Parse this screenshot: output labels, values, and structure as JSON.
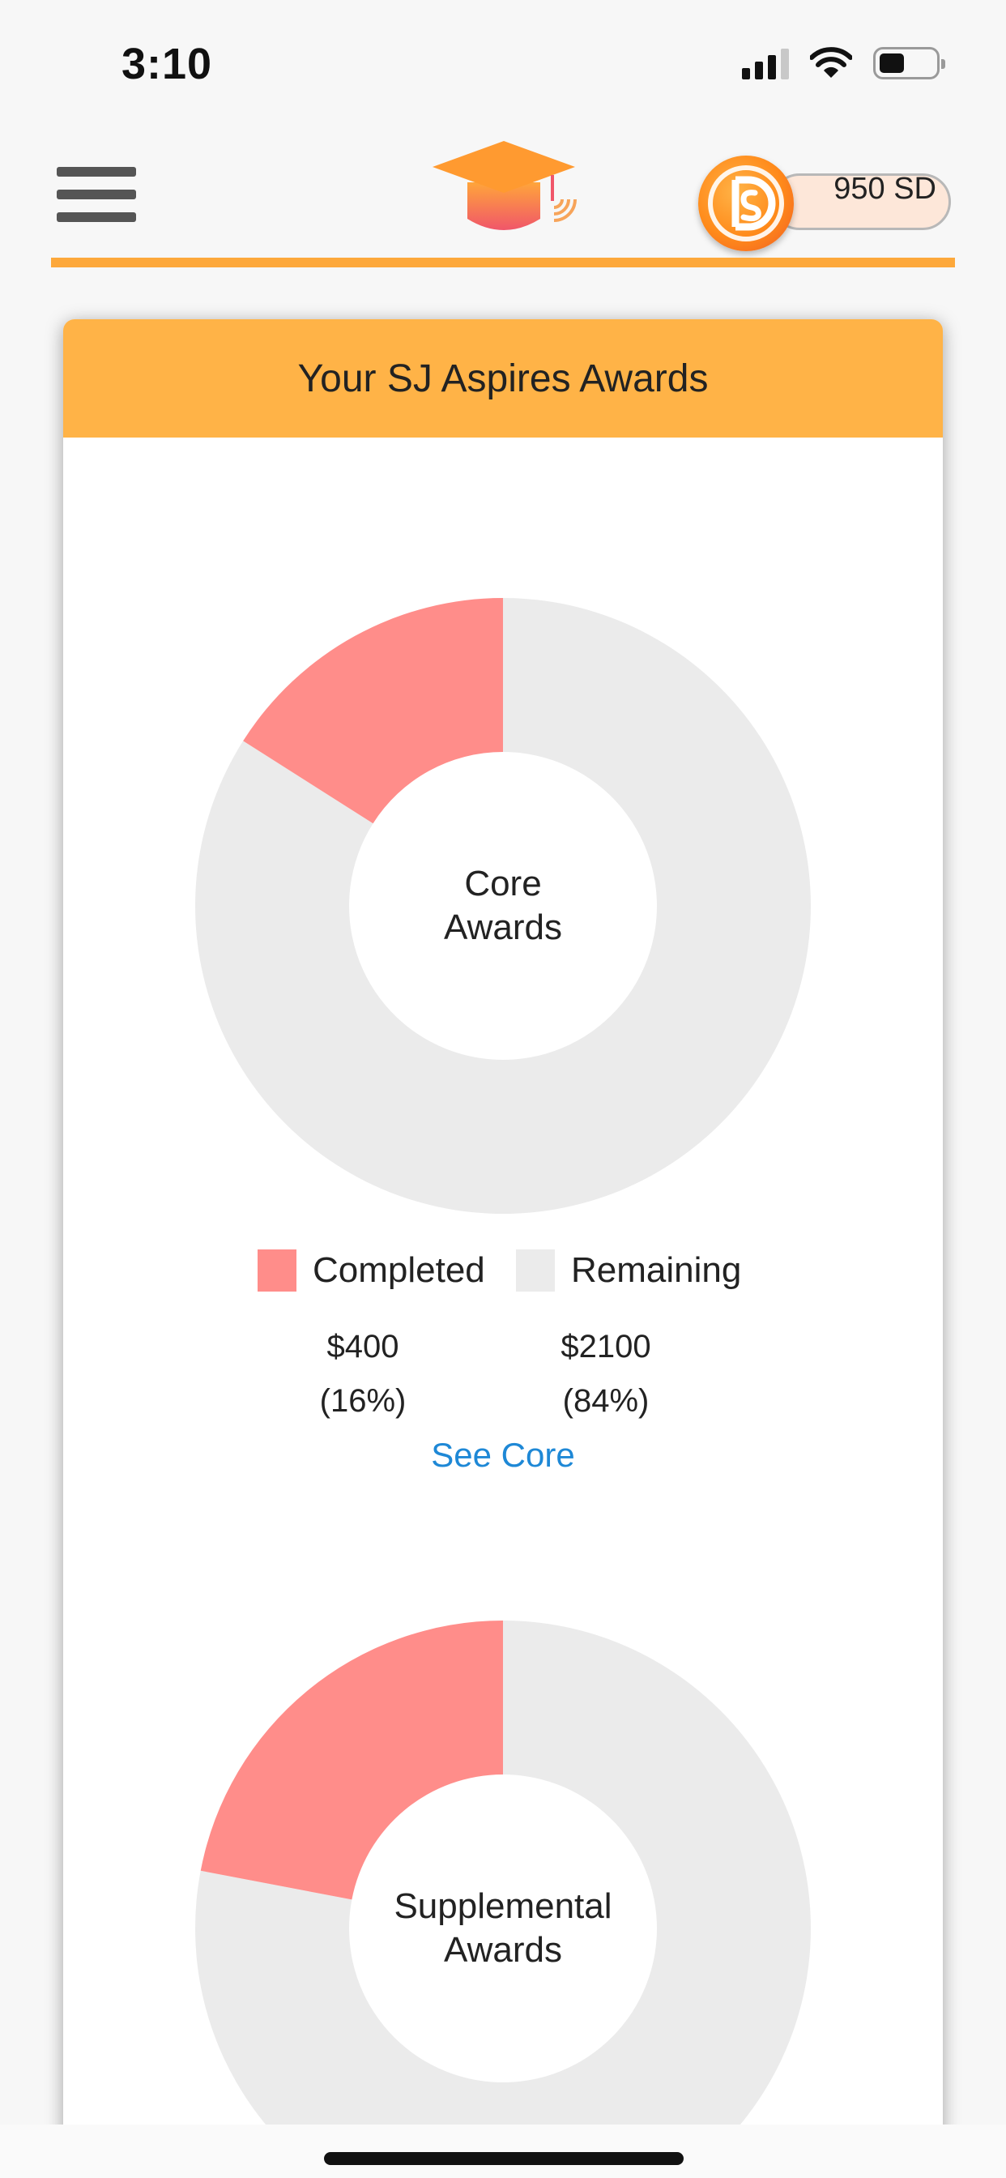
{
  "status_bar": {
    "time": "3:10",
    "icons": [
      "cellular-signal-icon",
      "wifi-icon",
      "battery-icon"
    ]
  },
  "header": {
    "menu_icon": "hamburger-menu-icon",
    "logo_icon": "graduation-cap-icon",
    "coin_icon": "sd-coin-icon",
    "balance": "950 SD",
    "accent_color": "#fda83b"
  },
  "card": {
    "title": "Your SJ Aspires Awards",
    "header_color": "#ffb347"
  },
  "colors": {
    "completed": "#ff8d8a",
    "remaining": "#ebebeb",
    "link": "#1e88d6"
  },
  "core": {
    "center_label_line1": "Core",
    "center_label_line2": "Awards",
    "completed_label": "Completed",
    "completed_value": "$400",
    "completed_pct": "(16%)",
    "remaining_label": "Remaining",
    "remaining_value": "$2100",
    "remaining_pct": "(84%)",
    "link_label": "See Core"
  },
  "supplemental": {
    "center_label_line1": "Supplemental",
    "center_label_line2": "Awards"
  },
  "chart_data": [
    {
      "type": "pie",
      "title": "Core Awards",
      "categories": [
        "Completed",
        "Remaining"
      ],
      "values": [
        400,
        2100
      ],
      "percentages": [
        16,
        84
      ]
    },
    {
      "type": "pie",
      "title": "Supplemental Awards",
      "categories": [
        "Completed",
        "Remaining"
      ],
      "values_percent_estimate": [
        22,
        78
      ]
    }
  ]
}
